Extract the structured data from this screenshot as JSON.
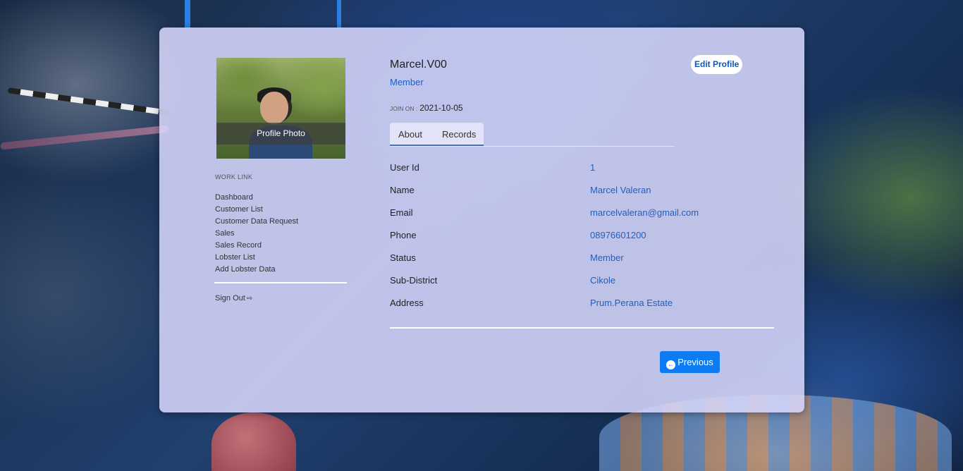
{
  "profile": {
    "photo_caption": "Profile Photo",
    "username": "Marcel.V00",
    "role": "Member",
    "join_label": "JOIN ON :",
    "join_date": "2021-10-05",
    "edit_button": "Edit Profile"
  },
  "sidebar": {
    "title": "WORK LINK",
    "items": [
      {
        "label": "Dashboard"
      },
      {
        "label": "Customer List"
      },
      {
        "label": "Customer Data Request"
      },
      {
        "label": "Sales"
      },
      {
        "label": "Sales Record"
      },
      {
        "label": "Lobster List"
      },
      {
        "label": "Add Lobster Data"
      }
    ],
    "signout": "Sign Out",
    "signout_icon": "sign-out-icon"
  },
  "tabs": [
    {
      "label": "About",
      "active": true
    },
    {
      "label": "Records",
      "active": false
    }
  ],
  "about": {
    "rows": [
      {
        "key": "User Id",
        "value": "1"
      },
      {
        "key": "Name",
        "value": "Marcel Valeran"
      },
      {
        "key": "Email",
        "value": "marcelvaleran@gmail.com"
      },
      {
        "key": "Phone",
        "value": "08976601200"
      },
      {
        "key": "Status",
        "value": "Member"
      },
      {
        "key": "Sub-District",
        "value": "Cikole"
      },
      {
        "key": "Address",
        "value": "Prum.Perana Estate"
      }
    ]
  },
  "nav": {
    "previous": "Previous",
    "previous_icon": "arrow-circle-left-icon"
  },
  "colors": {
    "accent": "#0d7cf2",
    "link": "#1f5fbf",
    "card": "#d6d6fa"
  }
}
